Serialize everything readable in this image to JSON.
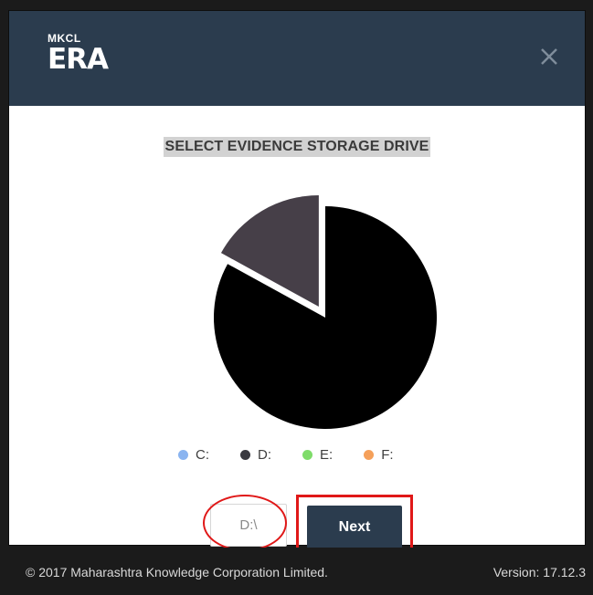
{
  "header": {
    "logo_small": "MKCL",
    "logo_big": "ERA",
    "close_label": "Close"
  },
  "main": {
    "heading": "SELECT EVIDENCE STORAGE DRIVE",
    "selected_drive": "D:\\",
    "next_label": "Next"
  },
  "chart_data": {
    "type": "pie",
    "slices": [
      {
        "label": "C:",
        "value": 0,
        "color": "#8ab4f0"
      },
      {
        "label": "D:",
        "value": 83,
        "color": "#000000"
      },
      {
        "label": "E:",
        "value": 0,
        "color": "#7fdc6a"
      },
      {
        "label": "F:",
        "value": 17,
        "color": "#f5a05a"
      }
    ],
    "highlight_colors": {
      "slice_alt": "#463f48"
    },
    "legend": [
      "C:",
      "D:",
      "E:",
      "F:"
    ],
    "legend_colors": [
      "#8ab4f0",
      "#3a3a40",
      "#7fdc6a",
      "#f5a05a"
    ]
  },
  "footer": {
    "copyright": "© 2017 Maharashtra Knowledge Corporation Limited.",
    "version": "Version: 17.12.3"
  }
}
